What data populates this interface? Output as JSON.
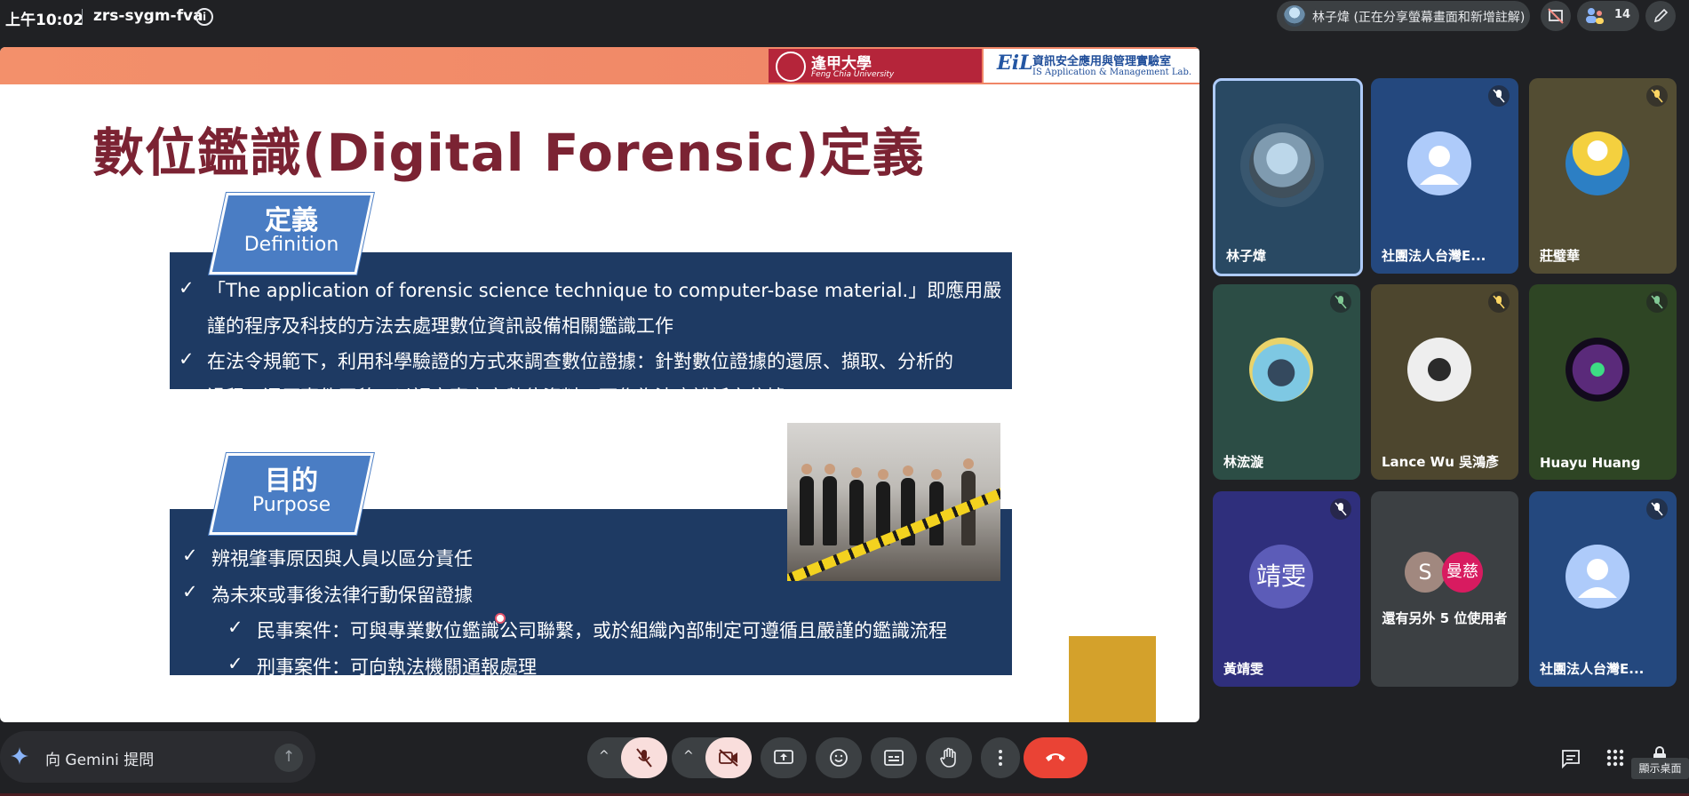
{
  "top_bar": {
    "time": "上午10:02",
    "meeting_code": "zrs-sygm-fva",
    "presenter_status": "林子煒 (正在分享螢幕畫面和新增註解)",
    "participant_count": "14"
  },
  "slide": {
    "title": "數位鑑識(Digital Forensic)定義",
    "logos": {
      "university_cn": "逢甲大學",
      "university_en": "Feng Chia University",
      "lab_mark": "EiL",
      "lab_cn": "資訊安全應用與管理實驗室",
      "lab_en": "IS Application & Management Lab."
    },
    "definition": {
      "tab_cn": "定義",
      "tab_en": "Definition",
      "lines": [
        "「The application of forensic science technique to computer-base material.」即應用嚴",
        "謹的程序及科技的方法去處理數位資訊設備相關鑑識工作",
        "在法令規範下，利用科學驗證的方式來調查數位證據：針對數位證據的還原、擷取、分析的",
        "過程，還原事件原貌，以認定事實之數位資料，可作為法庭訟訴之依據"
      ]
    },
    "purpose": {
      "tab_cn": "目的",
      "tab_en": "Purpose",
      "lines": [
        "辨視肇事原因與人員以區分責任",
        "為未來或事後法律行動保留證據",
        "民事案件：可與專業數位鑑識公司聯繫，或於組織內部制定可遵循且嚴謹的鑑識流程",
        "刑事案件：可向執法機關通報處理"
      ]
    },
    "check_mark": "✓"
  },
  "participants": [
    {
      "name": "林子煒",
      "avatar": "photo-avatar",
      "muted": false
    },
    {
      "name": "社團法人台灣E...",
      "avatar": "default-avatar",
      "muted": true
    },
    {
      "name": "莊璧華",
      "avatar": "flower-avatar",
      "muted": true
    },
    {
      "name": "林浤漩",
      "avatar": "cat-avatar",
      "muted": true
    },
    {
      "name": "Lance Wu 吳鴻彥",
      "avatar": "statue-avatar",
      "muted": true
    },
    {
      "name": "Huayu Huang",
      "avatar": "game-avatar",
      "muted": true
    },
    {
      "name": "黃靖雯",
      "avatar_text": "靖雯",
      "muted": true
    },
    {
      "name": "還有另外 5 位使用者",
      "avatar_letters": [
        "S",
        "曼慈"
      ],
      "muted": false
    },
    {
      "name": "社團法人台灣E...",
      "avatar": "default-avatar",
      "muted": true
    }
  ],
  "bottom_bar": {
    "gemini_prompt": "向 Gemini 提問",
    "tooltip": "顯示桌面"
  },
  "colors": {
    "accent_red": "#ea4335",
    "slide_title": "#7b2333",
    "panel": "#1e3a63",
    "tab": "#4a7dc4"
  }
}
